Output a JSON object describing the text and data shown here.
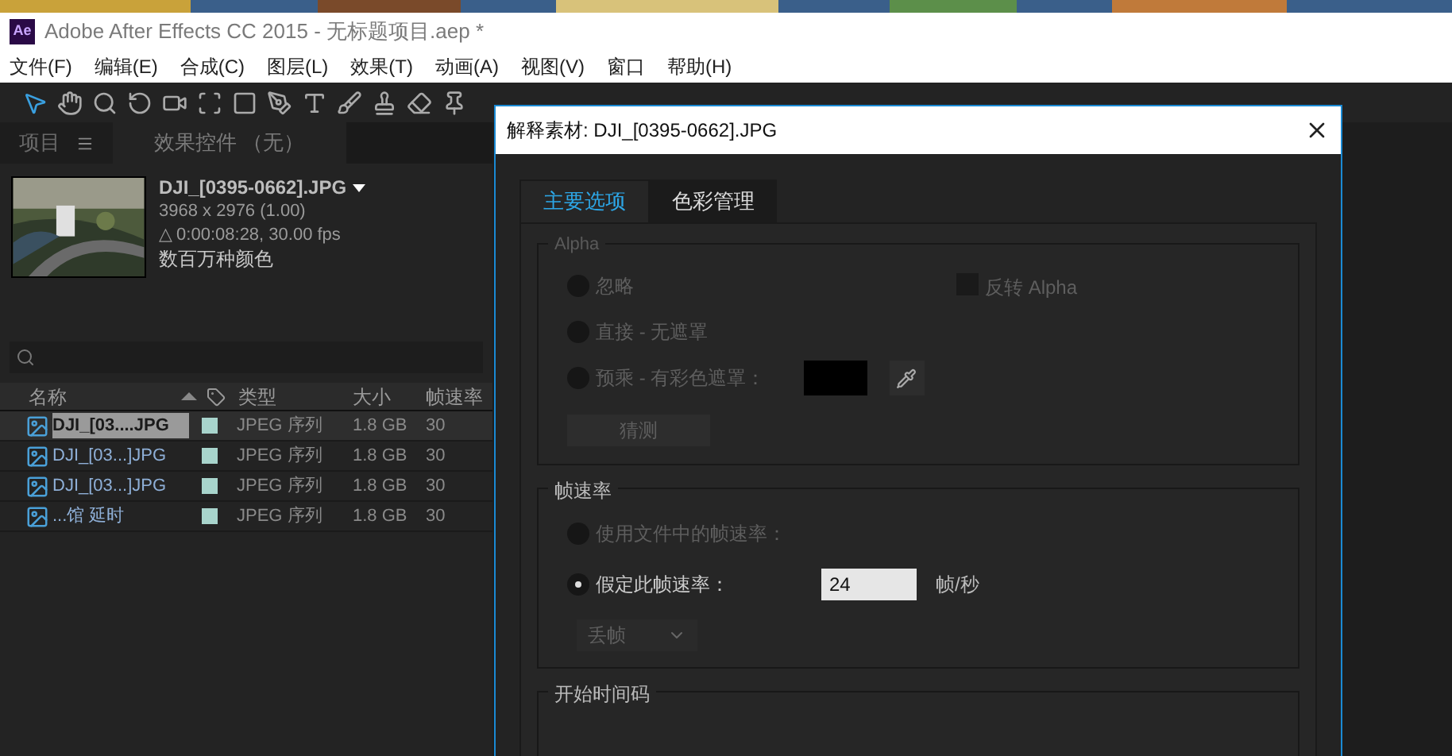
{
  "window": {
    "title": "Adobe After Effects CC 2015 - 无标题项目.aep *",
    "app_badge": "Ae"
  },
  "menu": [
    "文件(F)",
    "编辑(E)",
    "合成(C)",
    "图层(L)",
    "效果(T)",
    "动画(A)",
    "视图(V)",
    "窗口",
    "帮助(H)"
  ],
  "project_panel": {
    "tabs": [
      {
        "label": "项目",
        "selected": true
      },
      {
        "label": "效果控件 （无）",
        "selected": false
      }
    ],
    "footage": {
      "name": "DJI_[0395-0662].JPG",
      "dimensions": "3968 x 2976 (1.00)",
      "duration": "△ 0:00:08:28, 30.00 fps",
      "colors": "数百万种颜色"
    },
    "table": {
      "columns": [
        "名称",
        "类型",
        "大小",
        "帧速率"
      ],
      "rows": [
        {
          "name": "DJI_[03....JPG",
          "type": "JPEG 序列",
          "size": "1.8 GB",
          "fps": "30",
          "selected": true,
          "color": "#a8d4cc"
        },
        {
          "name": "DJI_[03...]JPG",
          "type": "JPEG 序列",
          "size": "1.8 GB",
          "fps": "30",
          "selected": false,
          "color": "#a8d4cc"
        },
        {
          "name": "DJI_[03...]JPG",
          "type": "JPEG 序列",
          "size": "1.8 GB",
          "fps": "30",
          "selected": false,
          "color": "#a8d4cc"
        },
        {
          "name": "...馆 延时",
          "type": "JPEG 序列",
          "size": "1.8 GB",
          "fps": "30",
          "selected": false,
          "color": "#a8d4cc"
        }
      ]
    }
  },
  "dialog": {
    "title": "解释素材: DJI_[0395-0662].JPG",
    "tabs": [
      {
        "label": "主要选项",
        "selected": true
      },
      {
        "label": "色彩管理",
        "selected": false
      }
    ],
    "alpha": {
      "title": "Alpha",
      "options": [
        {
          "label": "忽略",
          "selected": false,
          "disabled": true
        },
        {
          "label": "直接 - 无遮罩",
          "selected": false,
          "disabled": true
        },
        {
          "label": "预乘 - 有彩色遮罩：",
          "selected": false,
          "disabled": true
        }
      ],
      "invert": {
        "label": "反转 Alpha",
        "checked": false,
        "disabled": true
      },
      "guess_button": "猜测"
    },
    "frame_rate": {
      "title": "帧速率",
      "options": [
        {
          "label": "使用文件中的帧速率：",
          "selected": false,
          "disabled": true
        },
        {
          "label": "假定此帧速率：",
          "selected": true,
          "disabled": false
        }
      ],
      "value": "24",
      "unit": "帧/秒",
      "dropdown": "丢帧"
    },
    "start_timecode": {
      "title": "开始时间码"
    }
  }
}
